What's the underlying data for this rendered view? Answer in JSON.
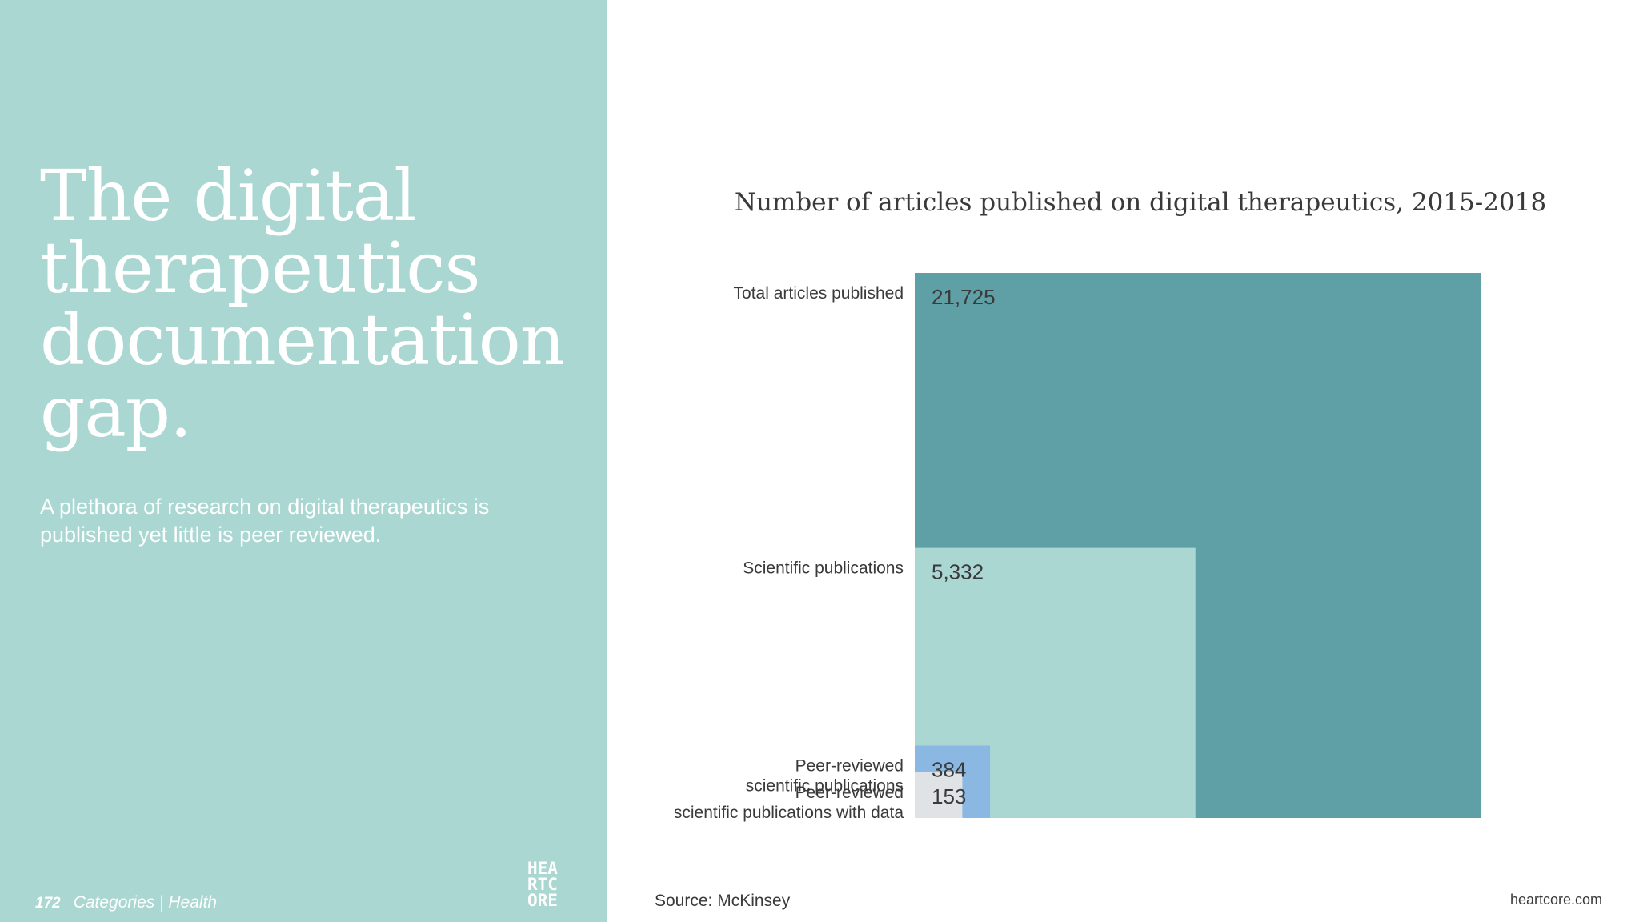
{
  "slide": {
    "headline": "The digital therapeutics documentation gap.",
    "subtitle": "A plethora of research on digital therapeutics is published yet little is peer reviewed.",
    "page_number": "172",
    "category": "Categories | Health",
    "logo_lines": [
      "HEA",
      "RTC",
      "ORE"
    ],
    "source": "Source: McKinsey",
    "website": "heartcore.com"
  },
  "colors": {
    "panel": "#abd7d2",
    "total": "#5ea0a6",
    "scientific": "#abd7d2",
    "peer_reviewed": "#8bb8e2",
    "with_data": "#e0e3e6",
    "text_dark": "#3a3a3a"
  },
  "chart_data": {
    "type": "area",
    "title": "Number of articles published on digital therapeutics, 2015-2018",
    "encoding": "nested squares (area proportional to value)",
    "categories": [
      "Total articles published",
      "Scientific publications",
      "Peer-reviewed scientific publications",
      "Peer-reviewed scientific publications with data"
    ],
    "values": [
      21725,
      5332,
      384,
      153
    ],
    "value_labels": [
      "21,725",
      "5,332",
      "384",
      "153"
    ],
    "label_lines": [
      [
        "Total articles published"
      ],
      [
        "Scientific publications"
      ],
      [
        "Peer-reviewed",
        "scientific publications"
      ],
      [
        "Peer-reviewed",
        "scientific publications with data"
      ]
    ]
  }
}
